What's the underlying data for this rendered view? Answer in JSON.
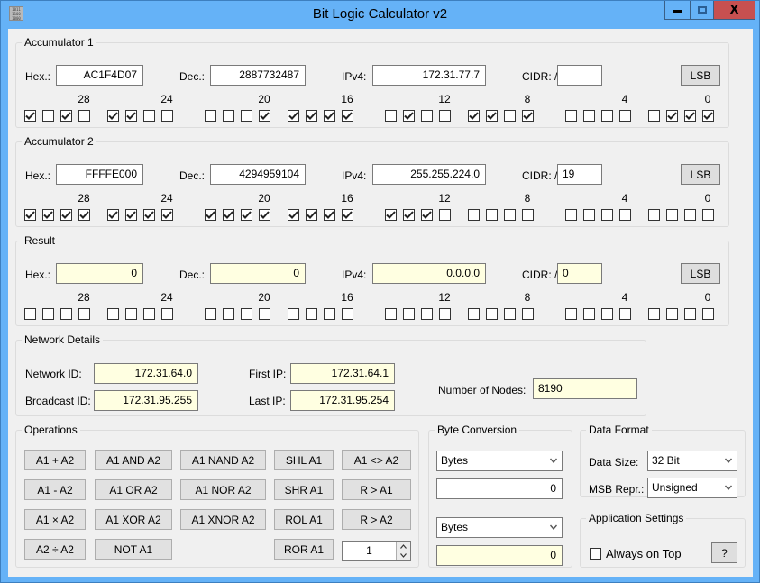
{
  "window": {
    "title": "Bit Logic Calculator v2",
    "icon_text": "1011 1100 1000",
    "controls": {
      "minimize": "minimize",
      "maximize": "maximize",
      "close": "X"
    }
  },
  "labels": {
    "hex": "Hex.:",
    "dec": "Dec.:",
    "ipv4": "IPv4:",
    "cidr": "CIDR: /",
    "lsb": "LSB",
    "bit_numbers": [
      "28",
      "24",
      "20",
      "16",
      "12",
      "8",
      "4",
      "0"
    ]
  },
  "accumulator1": {
    "title": "Accumulator 1",
    "hex": "AC1F4D07",
    "dec": "2887732487",
    "ipv4": "172.31.77.7",
    "cidr": "",
    "bits": "10101100000111110100110100000111"
  },
  "accumulator2": {
    "title": "Accumulator 2",
    "hex": "FFFFE000",
    "dec": "4294959104",
    "ipv4": "255.255.224.0",
    "cidr": "19",
    "bits": "11111111111111111110000000000000"
  },
  "result": {
    "title": "Result",
    "hex": "0",
    "dec": "0",
    "ipv4": "0.0.0.0",
    "cidr": "0",
    "bits": "00000000000000000000000000000000"
  },
  "network": {
    "title": "Network Details",
    "network_id_label": "Network ID:",
    "network_id": "172.31.64.0",
    "broadcast_id_label": "Broadcast ID:",
    "broadcast_id": "172.31.95.255",
    "first_ip_label": "First IP:",
    "first_ip": "172.31.64.1",
    "last_ip_label": "Last IP:",
    "last_ip": "172.31.95.254",
    "nodes_label": "Number of Nodes:",
    "nodes": "8190"
  },
  "operations": {
    "title": "Operations",
    "buttons": [
      "A1 + A2",
      "A1 AND A2",
      "A1 NAND A2",
      "SHL A1",
      "A1 <> A2",
      "A1 - A2",
      "A1 OR A2",
      "A1 NOR A2",
      "SHR A1",
      "R > A1",
      "A1 × A2",
      "A1 XOR A2",
      "A1 XNOR A2",
      "ROL A1",
      "R > A2",
      "A2 ÷ A2",
      "NOT A1",
      "ROR A1"
    ],
    "shift_amount": "1"
  },
  "byte_conversion": {
    "title": "Byte Conversion",
    "from_unit": "Bytes",
    "from_value": "0",
    "to_unit": "Bytes",
    "to_value": "0"
  },
  "data_format": {
    "title": "Data Format",
    "data_size_label": "Data Size:",
    "data_size": "32 Bit",
    "msb_label": "MSB Repr.:",
    "msb": "Unsigned"
  },
  "app_settings": {
    "title": "Application Settings",
    "always_on_top_label": "Always on Top",
    "always_on_top": false,
    "help_label": "?"
  },
  "colors": {
    "titlebar": "#65b2f7",
    "close_button": "#c75050",
    "readonly_field": "#ffffe1",
    "client_bg": "#f0f0f0"
  }
}
